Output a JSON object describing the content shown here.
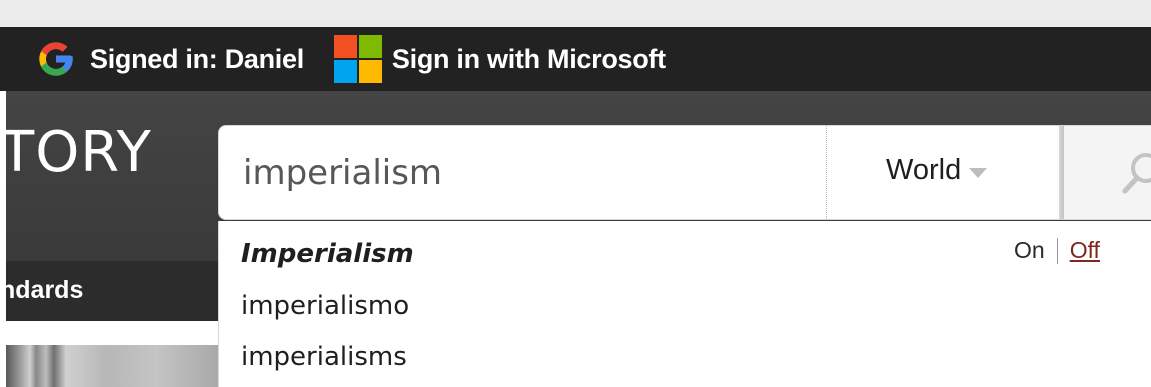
{
  "signin_bar": {
    "google": {
      "icon": "google-g-icon",
      "label": "Signed in: Daniel"
    },
    "microsoft": {
      "icon": "microsoft-logo-icon",
      "label": "Sign in with Microsoft"
    }
  },
  "header": {
    "brand_text": "TORY",
    "nav_item": "ndards"
  },
  "search": {
    "value": "imperialism",
    "scope": "World",
    "search_icon": "magnifier-icon"
  },
  "suggestions": {
    "items": [
      "Imperialism",
      "imperialismo",
      "imperialisms"
    ],
    "toggle_on": "On",
    "toggle_off": "Off"
  },
  "colors": {
    "signin_bar_bg": "#222222",
    "header_bg": "#3f3f3f",
    "off_link": "#7d2a1e",
    "google_blue": "#4285F4",
    "google_red": "#EA4335",
    "google_yellow": "#FBBC05",
    "google_green": "#34A853",
    "ms_red": "#F25022",
    "ms_green": "#7FBA00",
    "ms_blue": "#00A4EF",
    "ms_yellow": "#FFB900"
  }
}
